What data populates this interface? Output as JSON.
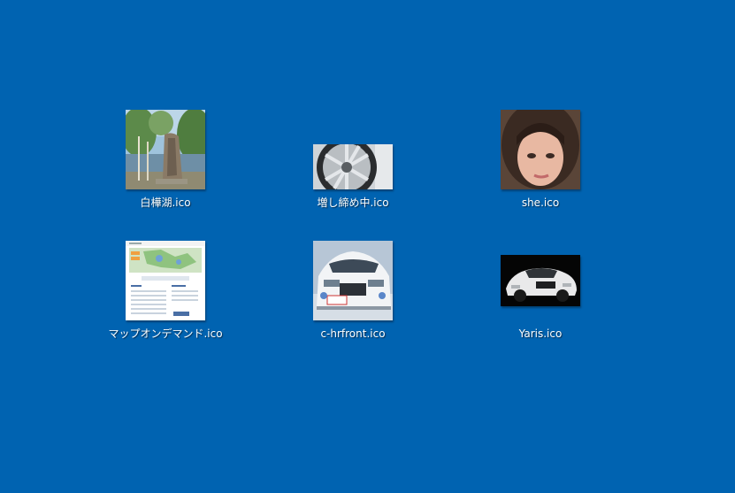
{
  "desktop": {
    "background_color": "#0063b1",
    "icons": [
      {
        "label": "白樺湖.ico",
        "icon": "lake-photo-thumbnail"
      },
      {
        "label": "増し締め中.ico",
        "icon": "wheel-photo-thumbnail"
      },
      {
        "label": "she.ico",
        "icon": "portrait-photo-thumbnail"
      },
      {
        "label": "マップオンデマンド.ico",
        "icon": "map-webpage-thumbnail"
      },
      {
        "label": "c-hrfront.ico",
        "icon": "white-car-photo-thumbnail"
      },
      {
        "label": "Yaris.ico",
        "icon": "yaris-car-photo-thumbnail"
      }
    ]
  }
}
